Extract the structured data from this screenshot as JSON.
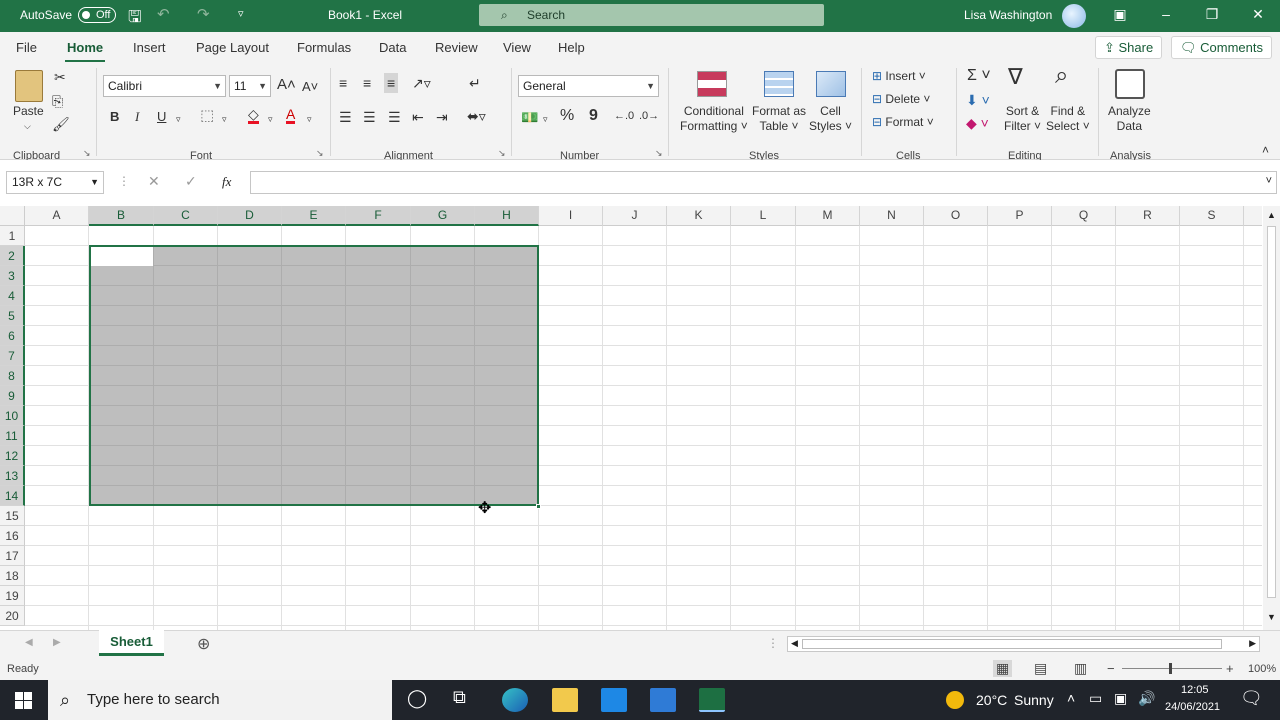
{
  "titlebar": {
    "autosave_label": "AutoSave",
    "autosave_state": "Off",
    "doc_title": "Book1  -  Excel",
    "search_placeholder": "Search",
    "user_name": "Lisa Washington"
  },
  "menu": {
    "tabs": [
      "File",
      "Home",
      "Insert",
      "Page Layout",
      "Formulas",
      "Data",
      "Review",
      "View",
      "Help"
    ],
    "active": "Home",
    "share_label": "Share",
    "comments_label": "Comments"
  },
  "ribbon": {
    "clipboard": {
      "paste": "Paste",
      "group": "Clipboard"
    },
    "font": {
      "name": "Calibri",
      "size": "11",
      "bold": "B",
      "italic": "I",
      "underline": "U",
      "font_color_glyph": "A",
      "group": "Font"
    },
    "alignment": {
      "group": "Alignment"
    },
    "number": {
      "format": "General",
      "percent": "%",
      "comma": "9",
      "group": "Number"
    },
    "styles": {
      "cond_format_1": "Conditional",
      "cond_format_2": "Formatting",
      "format_table_1": "Format as",
      "format_table_2": "Table",
      "cell_styles_1": "Cell",
      "cell_styles_2": "Styles",
      "group": "Styles"
    },
    "cells": {
      "insert": "Insert",
      "delete": "Delete",
      "format": "Format",
      "group": "Cells"
    },
    "editing": {
      "sort_1": "Sort &",
      "sort_2": "Filter",
      "find_1": "Find &",
      "find_2": "Select",
      "group": "Editing"
    },
    "analysis": {
      "analyze_1": "Analyze",
      "analyze_2": "Data",
      "group": "Analysis"
    }
  },
  "formula_bar": {
    "name_box": "13R x 7C",
    "fx_label": "fx",
    "formula_value": ""
  },
  "grid": {
    "columns": [
      "A",
      "B",
      "C",
      "D",
      "E",
      "F",
      "G",
      "H",
      "I",
      "J",
      "K",
      "L",
      "M",
      "N",
      "O",
      "P",
      "Q",
      "R",
      "S"
    ],
    "rows": [
      "1",
      "2",
      "3",
      "4",
      "5",
      "6",
      "7",
      "8",
      "9",
      "10",
      "11",
      "12",
      "13",
      "14",
      "15",
      "16",
      "17",
      "18",
      "19",
      "20"
    ],
    "selected_columns": [
      "B",
      "C",
      "D",
      "E",
      "F",
      "G",
      "H"
    ],
    "selected_rows": [
      "2",
      "3",
      "4",
      "5",
      "6",
      "7",
      "8",
      "9",
      "10",
      "11",
      "12",
      "13",
      "14"
    ],
    "selection_color": "#217346"
  },
  "sheets": {
    "tabs": [
      "Sheet1"
    ],
    "active": "Sheet1"
  },
  "status": {
    "mode": "Ready",
    "zoom": "100%",
    "minus": "−",
    "plus": "+"
  },
  "taskbar": {
    "search_placeholder": "Type here to search",
    "weather_temp": "20°C",
    "weather_desc": "Sunny",
    "time": "12:05",
    "date": "24/06/2021"
  },
  "colors": {
    "accent": "#217346",
    "title_bar": "#217346",
    "taskbar": "#20242b"
  }
}
